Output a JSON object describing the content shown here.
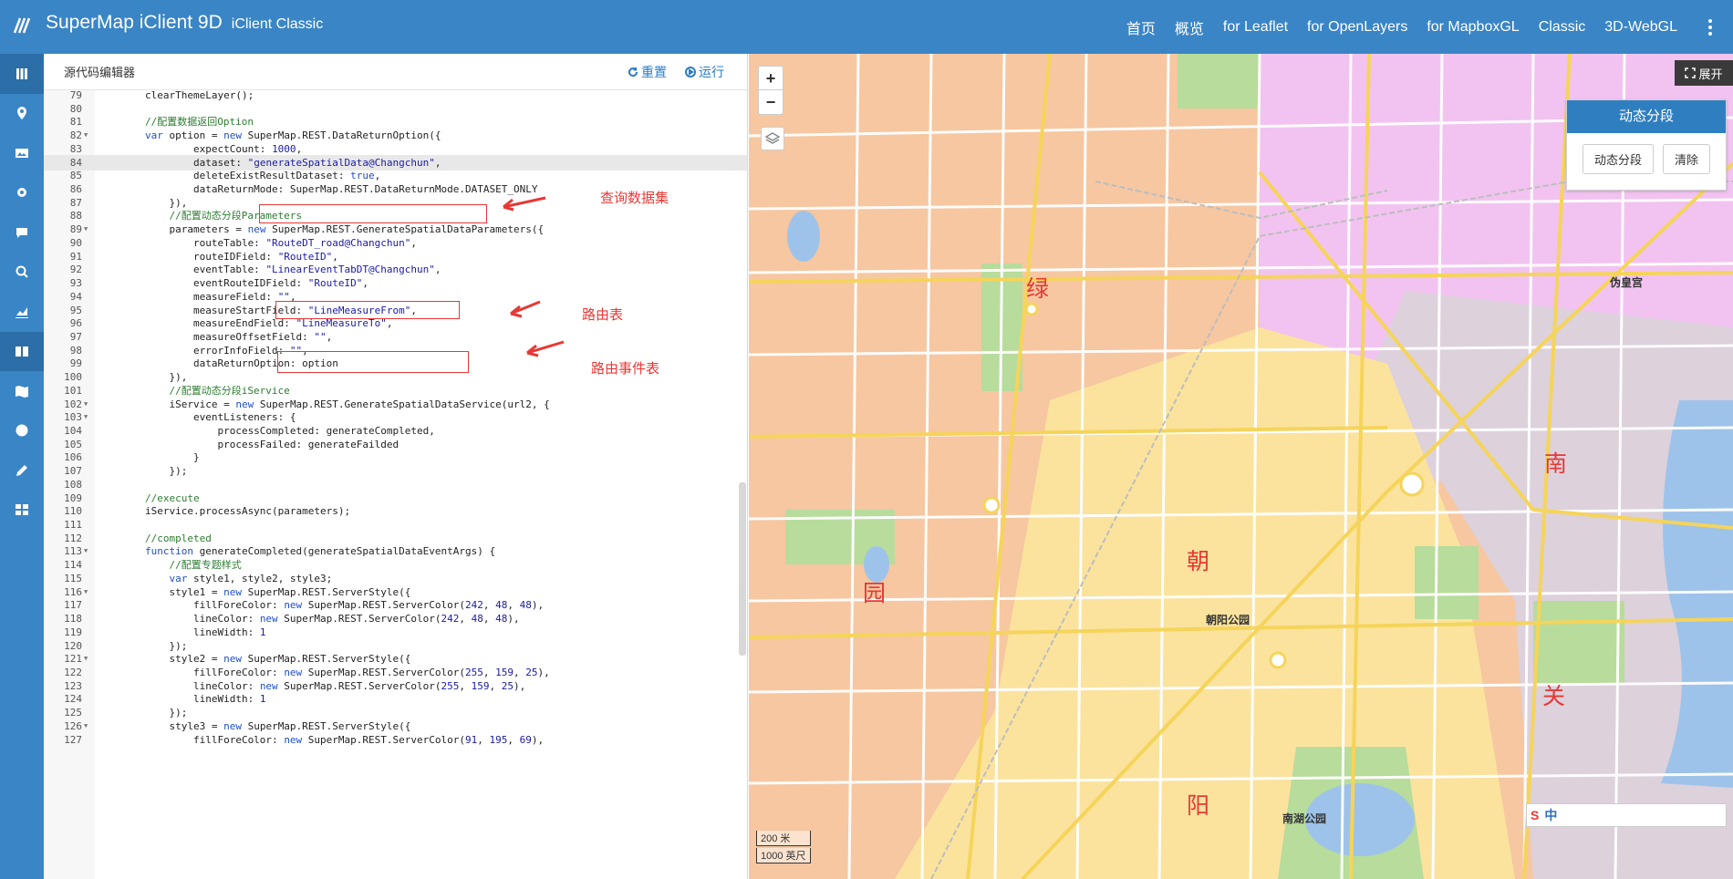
{
  "header": {
    "title": "SuperMap iClient 9D",
    "subtitle": "iClient Classic",
    "nav": [
      "首页",
      "概览",
      "for Leaflet",
      "for OpenLayers",
      "for MapboxGL",
      "Classic",
      "3D-WebGL"
    ]
  },
  "sidebar": {
    "icons": [
      "menu-icon",
      "map-marker-icon",
      "image-icon",
      "gear-icon",
      "comment-icon",
      "search-icon",
      "chart-icon",
      "book-icon",
      "map-icon",
      "globe-icon",
      "edit-icon",
      "grid-icon"
    ]
  },
  "editor": {
    "title": "源代码编辑器",
    "reset_label": "重置",
    "run_label": "运行",
    "annotations": {
      "dataset": "查询数据集",
      "route": "路由表",
      "event": "路由事件表"
    }
  },
  "map": {
    "expand_label": "展开",
    "zoom_in": "+",
    "zoom_out": "−",
    "panel_title": "动态分段",
    "panel_btn1": "动态分段",
    "panel_btn2": "清除",
    "labels": [
      "绿",
      "园",
      "朝",
      "阳",
      "南",
      "关"
    ],
    "parks": [
      "伪皇宫",
      "朝阳公园",
      "南湖公园"
    ],
    "scale_top": "200 米",
    "scale_bottom": "1000 英尺",
    "ime_text": "中"
  }
}
